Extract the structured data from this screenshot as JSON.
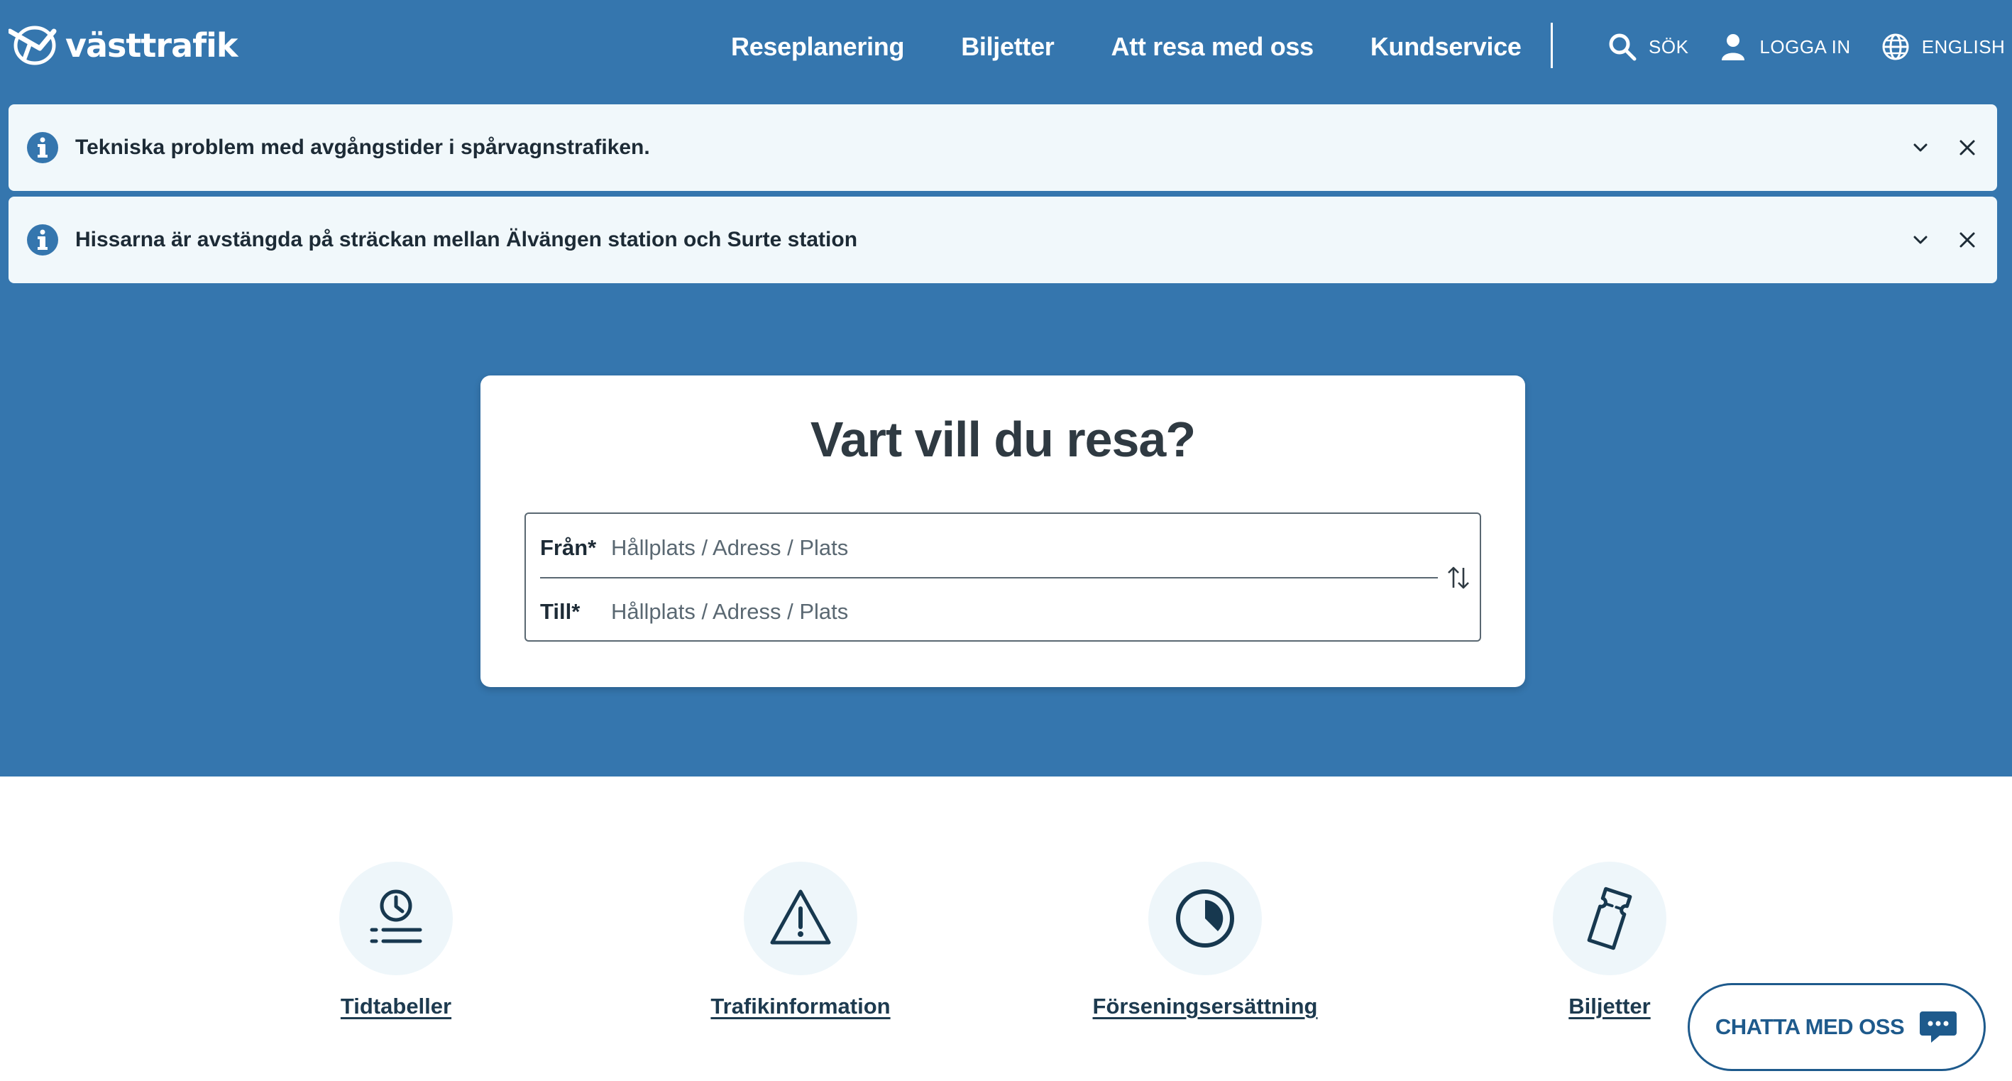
{
  "brand": {
    "name": "västtrafik"
  },
  "nav": {
    "items": [
      "Reseplanering",
      "Biljetter",
      "Att resa med oss",
      "Kundservice"
    ],
    "search_label": "SÖK",
    "login_label": "LOGGA IN",
    "language_label": "ENGLISH"
  },
  "alerts": [
    {
      "text": "Tekniska problem med avgångstider i spårvagnstrafiken."
    },
    {
      "text": "Hissarna är avstängda på sträckan mellan Älvängen station och Surte station"
    }
  ],
  "trip": {
    "heading": "Vart vill du resa?",
    "from_label": "Från*",
    "from_placeholder": "Hållplats / Adress / Plats",
    "from_value": "",
    "to_label": "Till*",
    "to_placeholder": "Hållplats / Adress / Plats",
    "to_value": ""
  },
  "quick_links": [
    {
      "label": "Tidtabeller",
      "icon": "clock-list-icon"
    },
    {
      "label": "Trafikinformation",
      "icon": "warning-triangle-icon"
    },
    {
      "label": "Förseningsersättning",
      "icon": "pie-clock-icon"
    },
    {
      "label": "Biljetter",
      "icon": "ticket-icon"
    }
  ],
  "chat": {
    "label": "CHATTA MED OSS"
  },
  "colors": {
    "brand_blue": "#3576ae",
    "alert_bg": "#f1f8fb",
    "dark_text": "#1d3a4f",
    "chat_blue": "#1e5a8c"
  }
}
